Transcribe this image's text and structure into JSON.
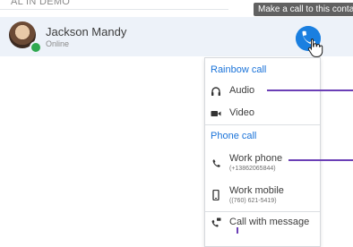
{
  "section": {
    "label": "AL IN DEMO"
  },
  "contact": {
    "name": "Jackson Mandy",
    "status": "Online"
  },
  "tooltip": {
    "text": "Make a call to this conta"
  },
  "menu": {
    "rainbow_header": "Rainbow call",
    "audio_label": "Audio",
    "video_label": "Video",
    "phone_header": "Phone call",
    "work_phone_label": "Work phone",
    "work_phone_number": "(+13862065844)",
    "work_mobile_label": "Work mobile",
    "work_mobile_number": "((760) 621-5419)",
    "call_message_label": "Call with message"
  },
  "colors": {
    "accent": "#1a7fe0",
    "annotation": "#6b3fb6",
    "presence": "#2fa84f",
    "row_bg": "#edf2f9"
  }
}
